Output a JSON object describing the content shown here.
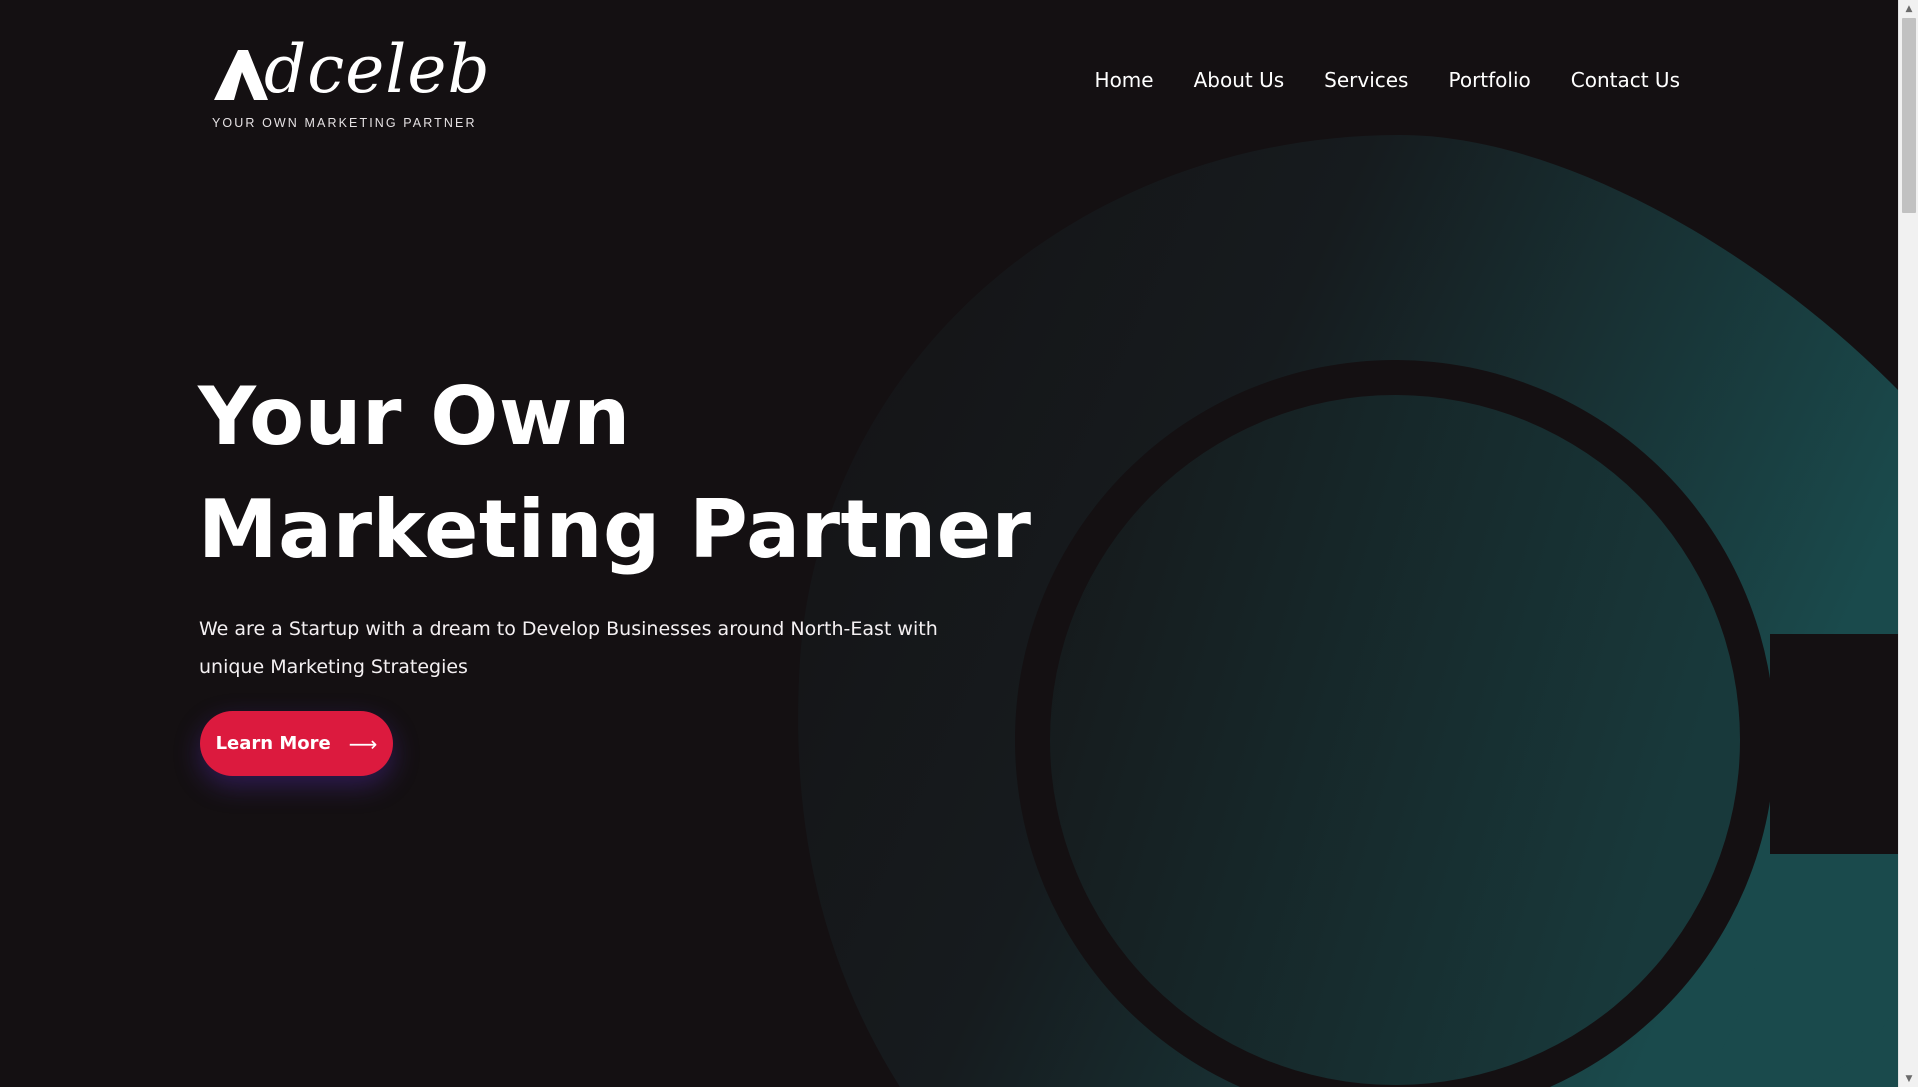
{
  "header": {
    "logo": {
      "script_text": "dceleb",
      "tagline": "YOUR OWN MARKETING PARTNER"
    },
    "nav": [
      {
        "label": "Home"
      },
      {
        "label": "About Us"
      },
      {
        "label": "Services"
      },
      {
        "label": "Portfolio"
      },
      {
        "label": "Contact Us"
      }
    ]
  },
  "hero": {
    "title_line1": "Your Own",
    "title_line2": "Marketing Partner",
    "subtitle": "We are a Startup with a dream to Develop Businesses around North-East with unique Marketing Strategies",
    "button_label": "Learn More",
    "button_icon": "arrow-right-icon"
  },
  "colors": {
    "background": "#141012",
    "accent": "#dc1a3e",
    "teal": "#1a4a4c",
    "text": "#ffffff"
  }
}
